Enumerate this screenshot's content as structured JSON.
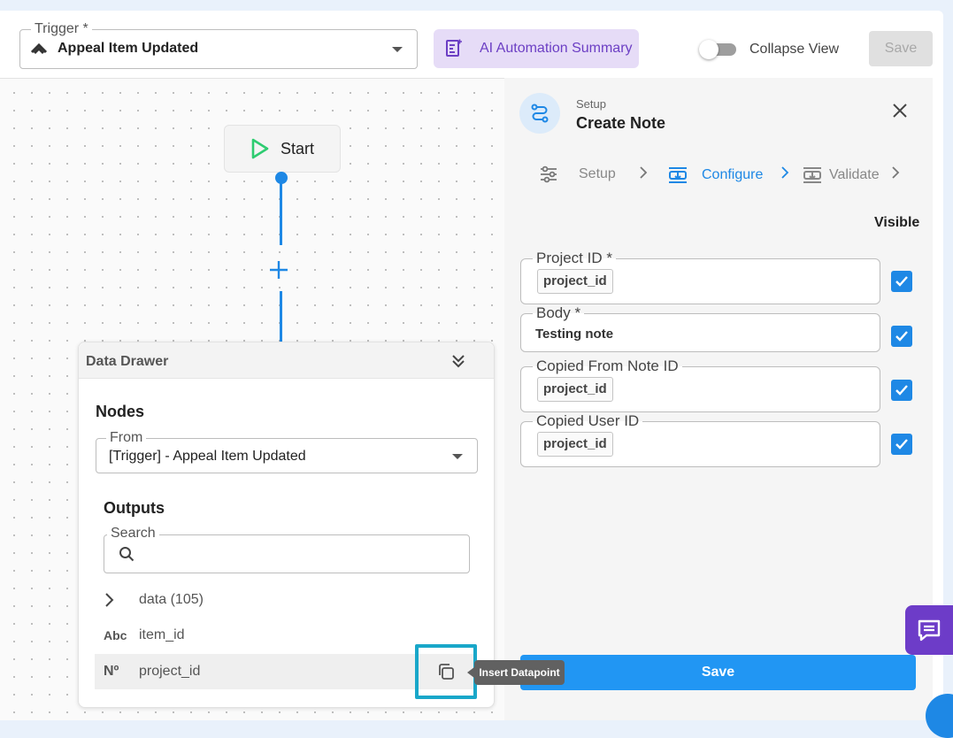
{
  "header": {
    "trigger_legend": "Trigger *",
    "trigger_value": "Appeal Item Updated",
    "ai_summary_label": "AI Automation Summary",
    "collapse_label": "Collapse View",
    "save_label": "Save"
  },
  "canvas": {
    "start_label": "Start"
  },
  "drawer": {
    "title": "Data Drawer",
    "nodes_title": "Nodes",
    "from_legend": "From",
    "from_value": "[Trigger] - Appeal Item Updated",
    "outputs_title": "Outputs",
    "search_legend": "Search",
    "rows": [
      {
        "icon": "chevron-right",
        "label": "data (105)"
      },
      {
        "icon": "Abc",
        "label": "item_id"
      },
      {
        "icon": "Nº",
        "label": "project_id"
      }
    ],
    "tooltip": "Insert Datapoint"
  },
  "panel": {
    "subtitle": "Setup",
    "title": "Create Note",
    "steps": [
      {
        "label": "Setup",
        "state": "done"
      },
      {
        "label": "Configure",
        "state": "active"
      },
      {
        "label": "Validate",
        "state": "pending"
      }
    ],
    "visible_label": "Visible",
    "fields": [
      {
        "label": "Project ID *",
        "value": "project_id",
        "chip": true,
        "visible": true
      },
      {
        "label": "Body *",
        "value": "Testing note",
        "chip": false,
        "visible": true
      },
      {
        "label": "Copied From Note ID",
        "value": "project_id",
        "chip": true,
        "visible": true
      },
      {
        "label": "Copied User ID",
        "value": "project_id",
        "chip": true,
        "visible": true
      }
    ],
    "save_label": "Save"
  },
  "colors": {
    "accent": "#1e88e5",
    "ai_bg": "#e6dcf7",
    "ai_text": "#6c3fc4",
    "start_green": "#2ecc71",
    "highlight_box": "#19a7c9"
  }
}
